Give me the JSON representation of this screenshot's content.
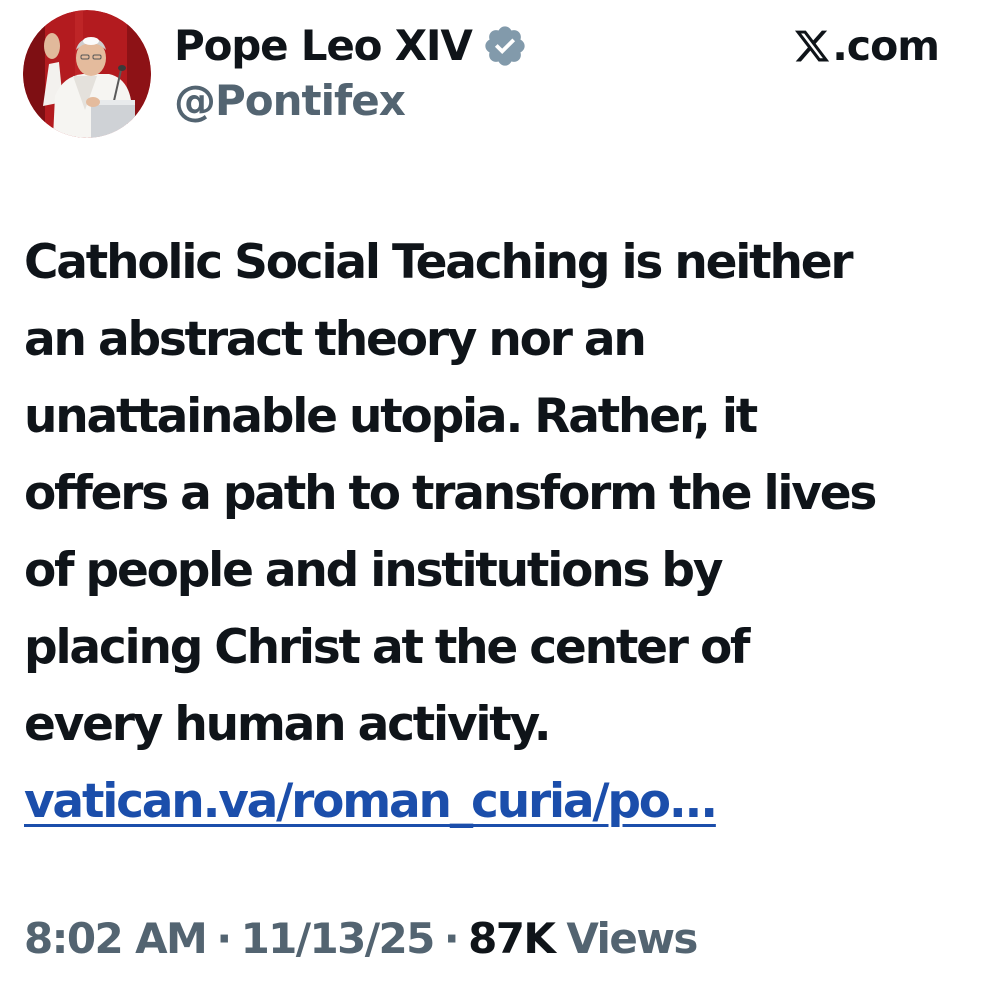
{
  "author": {
    "display_name": "Pope Leo XIV",
    "handle": "@Pontifex",
    "verified": true,
    "verified_color": "#829aab",
    "avatar_icon": "pope-waving-avatar"
  },
  "platform": {
    "logo_icon": "x-logo-icon",
    "domain": ".com"
  },
  "tweet": {
    "text_lines": [
      "Catholic Social Teaching is neither",
      "an abstract theory nor an",
      "unattainable utopia. Rather, it",
      "offers a path to transform the lives",
      "of people and institutions by",
      "placing Christ at the center of",
      "every human activity."
    ],
    "link": "vatican.va/roman_curia/po...",
    "link_color": "#1b4eab"
  },
  "meta": {
    "time": "8:02 AM",
    "separator": "·",
    "date": "11/13/25",
    "views_count": "87K",
    "views_label": "Views"
  },
  "colors": {
    "text_primary": "#0f1419",
    "text_secondary": "#536471",
    "background": "#ffffff"
  }
}
